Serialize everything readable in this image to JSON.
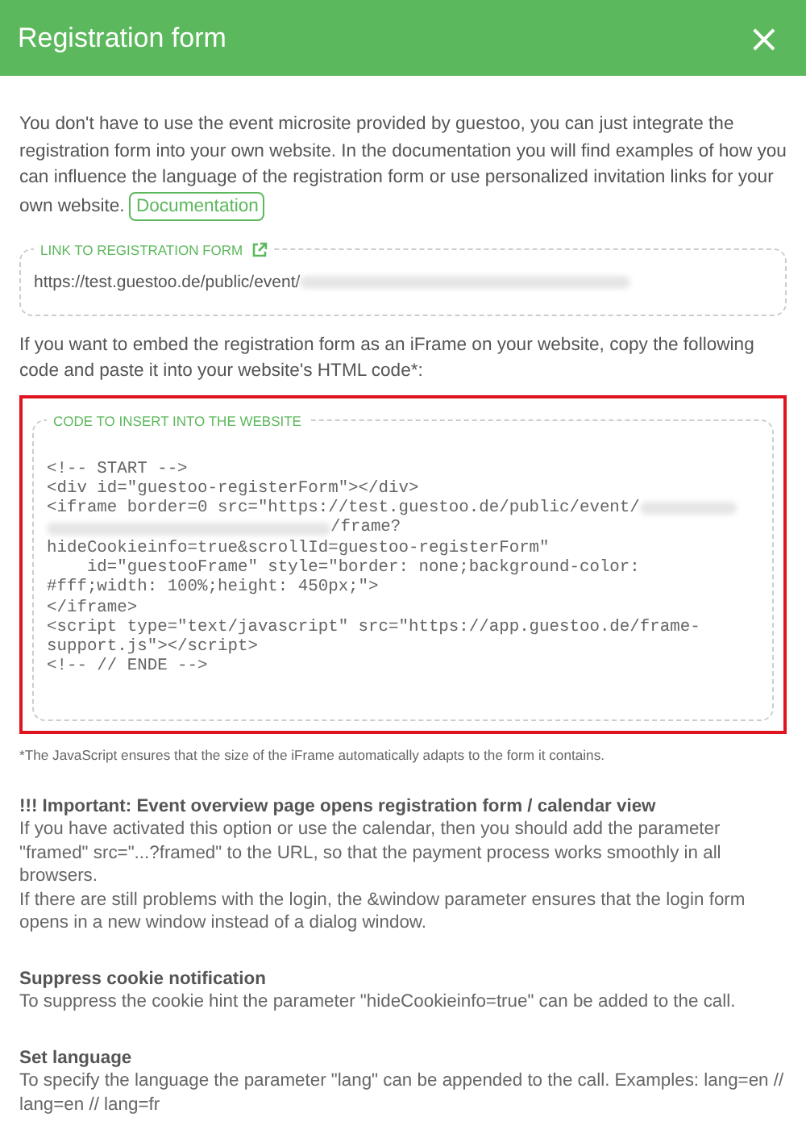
{
  "header": {
    "title": "Registration form",
    "close": "×"
  },
  "intro": {
    "text": "You don't have to use the event microsite provided by guestoo, you can just integrate the registration form into your own website. In the documentation you will find examples of how you can influence the language of the registration form or use personalized invitation links for your own website.",
    "link": "Documentation"
  },
  "link_field": {
    "label": "LINK TO REGISTRATION FORM",
    "value": "https://test.guestoo.de/public/event/"
  },
  "embed_text": "If you want to embed the registration form as an iFrame on your website, copy the following code and paste it into your website's HTML code*:",
  "code_field": {
    "label": "CODE TO INSERT INTO THE WEBSITE",
    "highlighted": true,
    "lines": [
      [
        {
          "kind": "text",
          "text": "<!-- START -->"
        }
      ],
      [
        {
          "kind": "text",
          "text": "<div id=\"guestoo-registerForm\"></div>"
        }
      ],
      [
        {
          "kind": "text",
          "text": "<iframe border=0 src=\"https://test.guestoo.de/public/event/"
        },
        {
          "kind": "blur"
        }
      ],
      [
        {
          "kind": "blur"
        },
        {
          "kind": "text",
          "text": "/frame?"
        }
      ],
      [
        {
          "kind": "text",
          "text": "hideCookieinfo=true&scrollId=guestoo-registerForm\""
        }
      ],
      [
        {
          "kind": "text",
          "text": "    id=\"guestooFrame\" style=\"border: none;background-color:"
        }
      ],
      [
        {
          "kind": "text",
          "text": "#fff;width: 100%;height: 450px;\">"
        }
      ],
      [
        {
          "kind": "text",
          "text": "</iframe>"
        }
      ],
      [
        {
          "kind": "text",
          "text": "<script type=\"text/javascript\" src=\"https://app.guestoo.de/frame-"
        }
      ],
      [
        {
          "kind": "text",
          "text": "support.js\"></script>"
        }
      ],
      [
        {
          "kind": "text",
          "text": "<!-- // ENDE -->"
        }
      ]
    ]
  },
  "footnote": "*The JavaScript ensures that the size of the iFrame automatically adapts to the form it contains.",
  "sections": [
    {
      "heading": "!!! Important: Event overview page opens registration form / calendar view",
      "paragraphs": [
        "If you have activated this option or use the calendar, then you should add the parameter \"framed\" src=\"...?framed\" to the URL, so that the payment process works smoothly in all browsers.",
        "If there are still problems with the login, the &window parameter ensures that the login form opens in a new window instead of a dialog window."
      ]
    },
    {
      "heading": "Suppress cookie notification",
      "paragraphs": [
        "To suppress the cookie hint the parameter \"hideCookieinfo=true\" can be added to the call."
      ]
    },
    {
      "heading": "Set language",
      "paragraphs": [
        "To specify the language the parameter \"lang\" can be appended to the call. Examples: lang=en // lang=en // lang=fr"
      ]
    }
  ]
}
